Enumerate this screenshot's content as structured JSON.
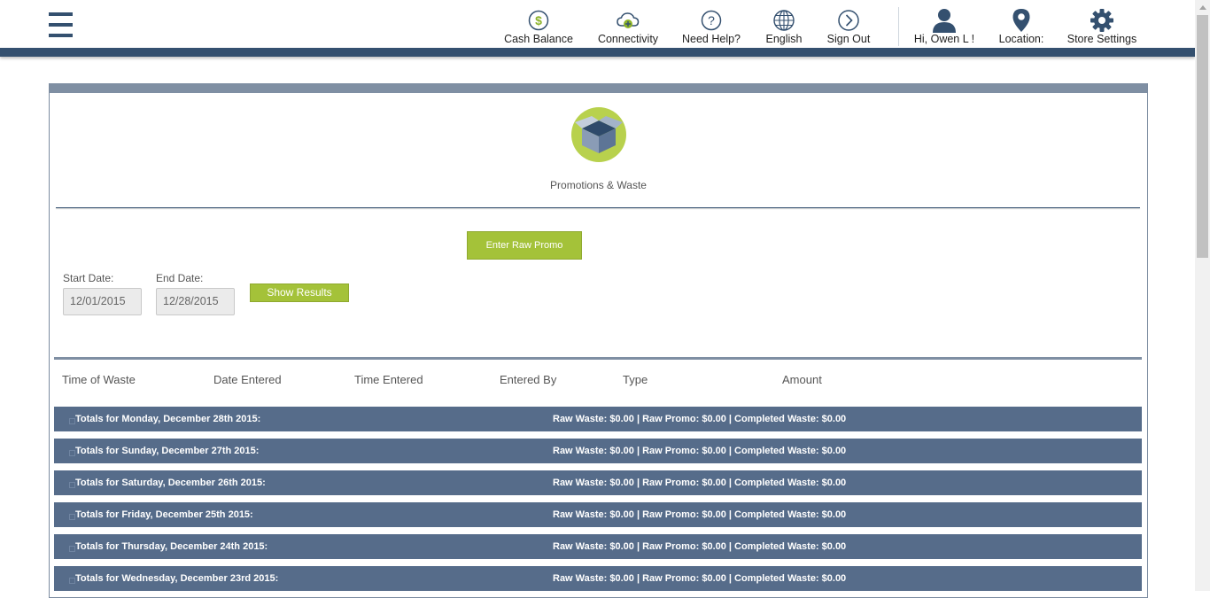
{
  "header": {
    "nav": [
      {
        "label": "Cash Balance",
        "icon": "dollar-circle-icon"
      },
      {
        "label": "Connectivity",
        "icon": "cloud-connect-icon"
      },
      {
        "label": "Need Help?",
        "icon": "question-circle-icon"
      },
      {
        "label": "English",
        "icon": "globe-icon"
      },
      {
        "label": "Sign Out",
        "icon": "chevron-right-circle-icon"
      },
      {
        "label": "Hi,  Owen L !",
        "icon": "user-icon"
      },
      {
        "label": "Location:",
        "icon": "map-pin-icon"
      },
      {
        "label": "Store Settings",
        "icon": "gear-icon"
      }
    ],
    "colors": {
      "brand": "#34506f",
      "accent": "#a4c239"
    }
  },
  "page": {
    "title": "Promotions & Waste",
    "enter_button": "Enter Raw Promo",
    "start_date_label": "Start Date:",
    "start_date_value": "12/01/2015",
    "end_date_label": "End Date:",
    "end_date_value": "12/28/2015",
    "show_button": "Show Results"
  },
  "table": {
    "columns": [
      "Time of Waste",
      "Date Entered",
      "Time Entered",
      "Entered By",
      "Type",
      "Amount"
    ],
    "totals": [
      {
        "label": "Totals for Monday, December 28th 2015:",
        "summary": "Raw Waste: $0.00 | Raw Promo: $0.00 | Completed Waste: $0.00"
      },
      {
        "label": "Totals for Sunday, December 27th 2015:",
        "summary": "Raw Waste: $0.00 | Raw Promo: $0.00 | Completed Waste: $0.00"
      },
      {
        "label": "Totals for Saturday, December 26th 2015:",
        "summary": "Raw Waste: $0.00 | Raw Promo: $0.00 | Completed Waste: $0.00"
      },
      {
        "label": "Totals for Friday, December 25th 2015:",
        "summary": "Raw Waste: $0.00 | Raw Promo: $0.00 | Completed Waste: $0.00"
      },
      {
        "label": "Totals for Thursday, December 24th 2015:",
        "summary": "Raw Waste: $0.00 | Raw Promo: $0.00 | Completed Waste: $0.00"
      },
      {
        "label": "Totals for Wednesday, December 23rd 2015:",
        "summary": "Raw Waste: $0.00 | Raw Promo: $0.00 | Completed Waste: $0.00"
      }
    ]
  }
}
